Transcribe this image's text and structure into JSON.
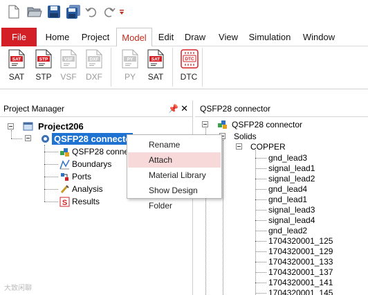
{
  "quick_access": {
    "icons": [
      "new-file-icon",
      "open-folder-icon",
      "save-icon",
      "save-all-icon",
      "undo-icon",
      "redo-icon",
      "customize-dropdown-icon"
    ]
  },
  "ribbon_tabs": [
    "File",
    "Home",
    "Project",
    "Model",
    "Edit",
    "Draw",
    "View",
    "Simulation",
    "Window"
  ],
  "active_tab": "Model",
  "ribbon_buttons": {
    "import_sat": {
      "label": "SAT",
      "badge": "SAT"
    },
    "import_stp": {
      "label": "STP",
      "badge": "STP"
    },
    "import_vsf": {
      "label": "VSF",
      "badge": "VSF"
    },
    "import_dxf": {
      "label": "DXF",
      "badge": "DXF"
    },
    "export_py": {
      "label": "PY",
      "badge": "PY"
    },
    "export_sat": {
      "label": "SAT",
      "badge": "SAT"
    },
    "dtc": {
      "label": "DTC",
      "badge": "DTC"
    }
  },
  "project_manager": {
    "title": "Project Manager",
    "pin_glyph": "📌",
    "close_glyph": "✕",
    "root": "Project206",
    "design": "QSFP28 connector",
    "design_visible": "QSFP28 connecto",
    "children": [
      "QSFP28 conne",
      "Boundarys",
      "Ports",
      "Analysis",
      "Results"
    ]
  },
  "context_menu": {
    "items": [
      "Rename",
      "Attach",
      "Material Library",
      "Show Design Folder"
    ],
    "hovered": "Attach"
  },
  "model_tree": {
    "title": "QSFP28 connector",
    "root": "QSFP28 connector",
    "solids_label": "Solids",
    "material": "COPPER",
    "parts": [
      "gnd_lead3",
      "signal_lead1",
      "signal_lead2",
      "gnd_lead4",
      "gnd_lead1",
      "signal_lead3",
      "signal_lead4",
      "gnd_lead2",
      "1704320001_125",
      "1704320001_129",
      "1704320001_133",
      "1704320001_137",
      "1704320001_141",
      "1704320001_145"
    ]
  },
  "watermark": "大致闲聊",
  "colors": {
    "file_tab": "#d32027",
    "selection": "#1e73d2",
    "menu_hover": "#f7d9d9",
    "accent_red": "#c42b1c"
  }
}
